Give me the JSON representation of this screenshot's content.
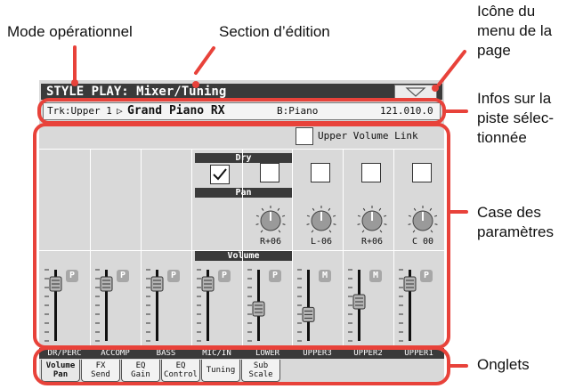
{
  "annotations": {
    "mode": "Mode opérationnel",
    "edit_section": "Section d’édition",
    "page_menu_line1": "Icône du",
    "page_menu_line2": "menu de la",
    "page_menu_line3": "page",
    "track_info_line1": "Infos sur la",
    "track_info_line2": "piste sélec-",
    "track_info_line3": "tionnée",
    "params_line1": "Case des",
    "params_line2": "paramètres",
    "tabs": "Onglets",
    "accent_color": "#e8423a"
  },
  "screen": {
    "title": "STYLE PLAY: Mixer/Tuning",
    "track_info": {
      "track": "Trk:Upper 1",
      "arrow": "▷",
      "sound": "Grand Piano RX",
      "bank": "B:Piano",
      "program": "121.010.0"
    },
    "upper_volume_link": "Upper Volume Link",
    "dry_label": "Dry",
    "pan_label": "Pan",
    "volume_label": "Volume",
    "dry_checks": [
      true,
      false,
      false,
      false,
      false
    ],
    "pans": [
      "R+06",
      "L-06",
      "R+06",
      "C 00"
    ],
    "channels": [
      {
        "name": "DR/PERC",
        "volume": "127",
        "badge": "P",
        "fader_level": 0.8
      },
      {
        "name": "ACCOMP",
        "volume": "127",
        "badge": "P",
        "fader_level": 0.8
      },
      {
        "name": "BASS",
        "volume": "127",
        "badge": "P",
        "fader_level": 0.8
      },
      {
        "name": "MIC/IN",
        "volume": "127",
        "badge": "P",
        "fader_level": 0.8
      },
      {
        "name": "LOWER",
        "volume": "55",
        "badge": "P",
        "fader_level": 0.45
      },
      {
        "name": "UPPER3",
        "volume": "47",
        "badge": "M",
        "fader_level": 0.37
      },
      {
        "name": "UPPER2",
        "volume": "69",
        "badge": "M",
        "fader_level": 0.55
      },
      {
        "name": "UPPER1",
        "volume": "116",
        "badge": "P",
        "fader_level": 0.8
      }
    ],
    "tabs": [
      {
        "line1": "Volume",
        "line2": "Pan",
        "active": true
      },
      {
        "line1": "FX",
        "line2": "Send",
        "active": false
      },
      {
        "line1": "EQ",
        "line2": "Gain",
        "active": false
      },
      {
        "line1": "EQ",
        "line2": "Control",
        "active": false
      },
      {
        "line1": "Tuning",
        "line2": "",
        "active": false
      },
      {
        "line1": "Sub",
        "line2": "Scale",
        "active": false
      }
    ]
  }
}
